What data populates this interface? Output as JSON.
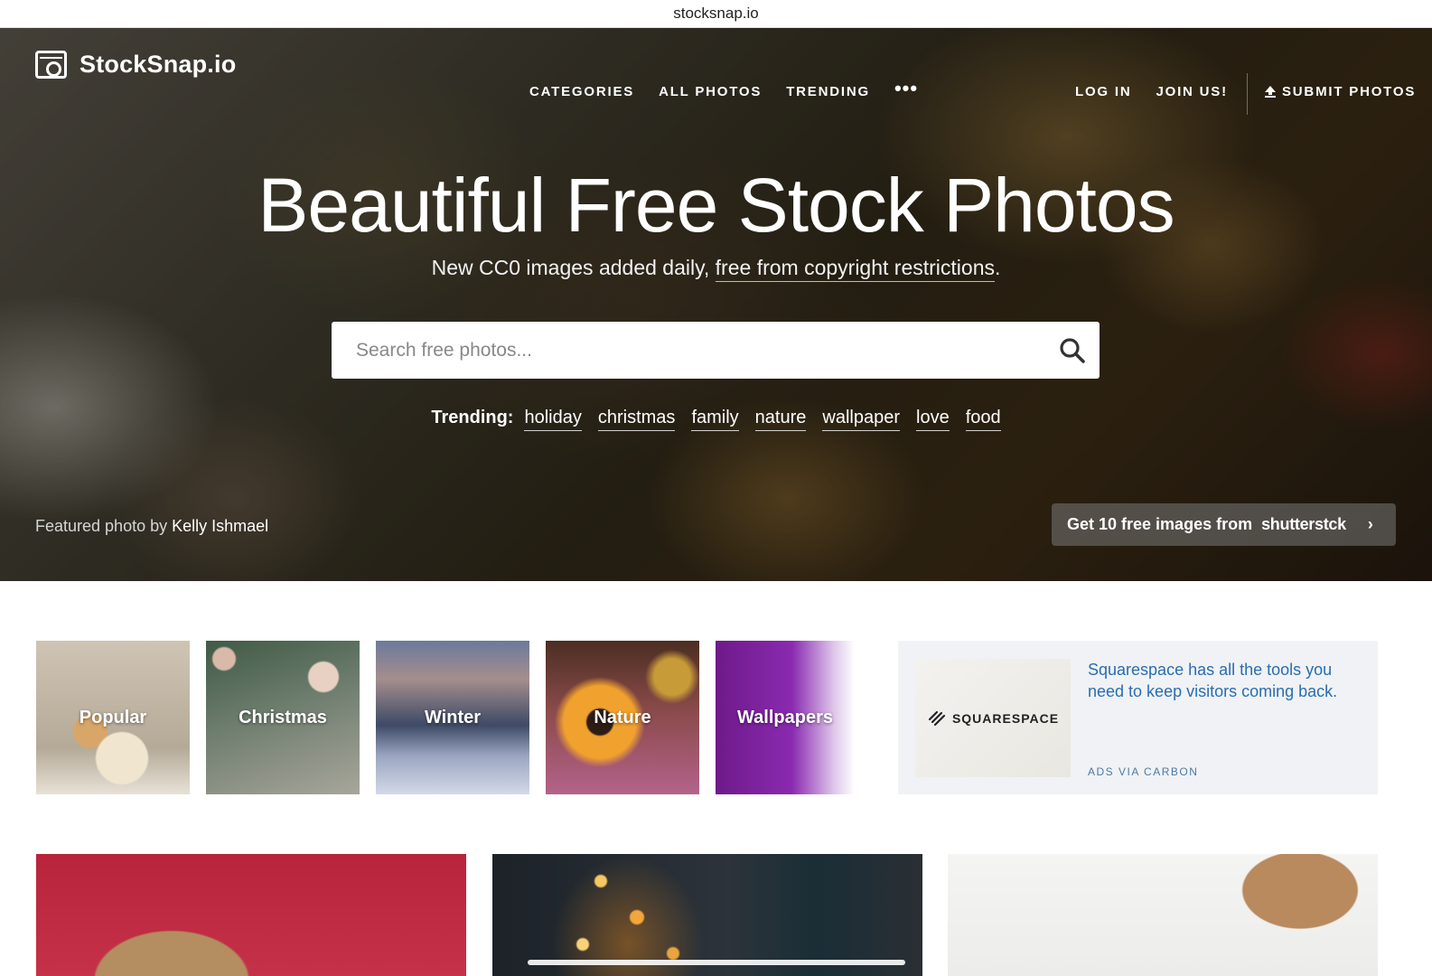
{
  "browser": {
    "url": "stocksnap.io"
  },
  "header": {
    "logo_text": "StockSnap.io",
    "nav": [
      "CATEGORIES",
      "ALL PHOTOS",
      "TRENDING"
    ],
    "more": "•••",
    "login": "LOG IN",
    "join": "JOIN US!",
    "submit": "SUBMIT PHOTOS"
  },
  "hero": {
    "title": "Beautiful Free Stock Photos",
    "subtitle_prefix": "New CC0 images added daily, ",
    "subtitle_link": "free from copyright restrictions",
    "subtitle_suffix": ".",
    "search_placeholder": "Search free photos...",
    "trending_label": "Trending:",
    "trending_tags": [
      "holiday",
      "christmas",
      "family",
      "nature",
      "wallpaper",
      "love",
      "food"
    ],
    "featured_prefix": "Featured photo by",
    "featured_author": "Kelly Ishmael",
    "promo_text": "Get 10 free images from",
    "promo_brand": "shutterstck"
  },
  "categories": [
    "Popular",
    "Christmas",
    "Winter",
    "Nature",
    "Wallpapers"
  ],
  "ad": {
    "brand": "SQUARESPACE",
    "text": "Squarespace has all the tools you need to keep visitors coming back.",
    "via": "ADS VIA CARBON"
  },
  "colors": {
    "ad_link": "#2a6db0",
    "ad_bg": "#f0f2f5"
  }
}
